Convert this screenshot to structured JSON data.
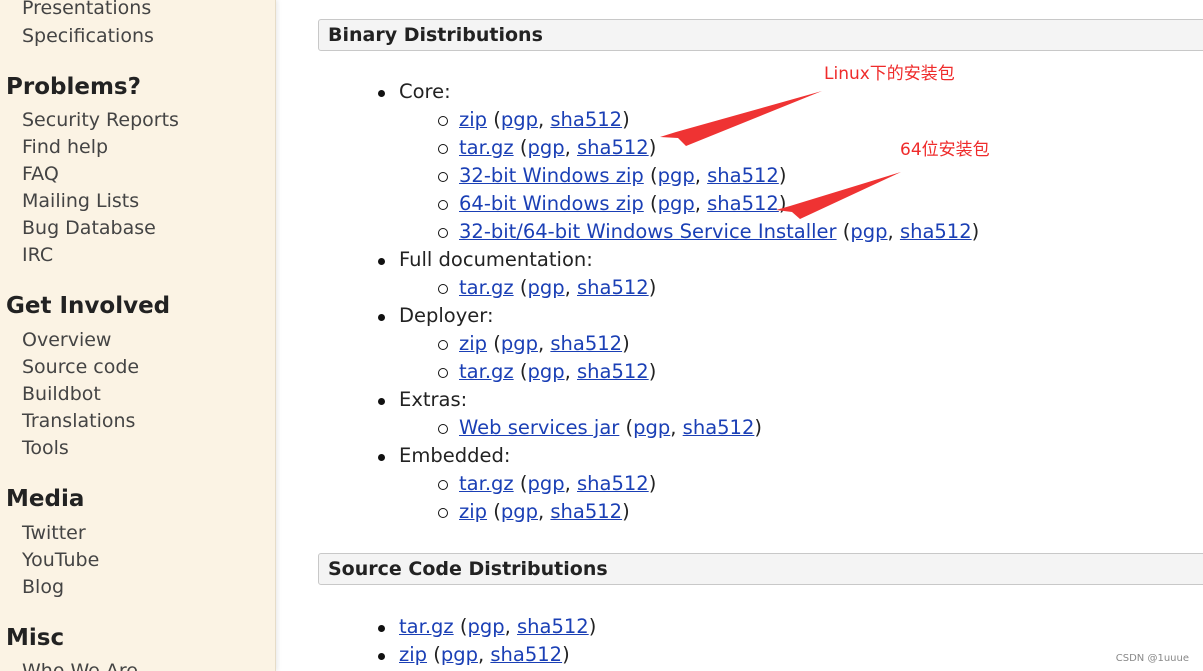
{
  "sidebar": {
    "top_items": [
      "Presentations",
      "Specifications"
    ],
    "sections": [
      {
        "heading": "Problems?",
        "items": [
          "Security Reports",
          "Find help",
          "FAQ",
          "Mailing Lists",
          "Bug Database",
          "IRC"
        ]
      },
      {
        "heading": "Get Involved",
        "items": [
          "Overview",
          "Source code",
          "Buildbot",
          "Translations",
          "Tools"
        ]
      },
      {
        "heading": "Media",
        "items": [
          "Twitter",
          "YouTube",
          "Blog"
        ]
      },
      {
        "heading": "Misc",
        "items": [
          "Who We Are"
        ]
      }
    ]
  },
  "binary": {
    "heading": "Binary Distributions",
    "core_label": "Core:",
    "core": {
      "zip": "zip",
      "zip_pgp": "pgp",
      "zip_sha": "sha512",
      "targz": "tar.gz",
      "targz_pgp": "pgp",
      "targz_sha": "sha512",
      "win32": "32-bit Windows zip",
      "win32_pgp": "pgp",
      "win32_sha": "sha512",
      "win64": "64-bit Windows zip",
      "win64_pgp": "pgp",
      "win64_sha": "sha512",
      "installer": "32-bit/64-bit Windows Service Installer",
      "installer_pgp": "pgp",
      "installer_sha": "sha512"
    },
    "fulldoc_label": "Full documentation:",
    "fulldoc": {
      "targz": "tar.gz",
      "targz_pgp": "pgp",
      "targz_sha": "sha512"
    },
    "deployer_label": "Deployer:",
    "deployer": {
      "zip": "zip",
      "zip_pgp": "pgp",
      "zip_sha": "sha512",
      "targz": "tar.gz",
      "targz_pgp": "pgp",
      "targz_sha": "sha512"
    },
    "extras_label": "Extras:",
    "extras": {
      "ws": "Web services jar",
      "ws_pgp": "pgp",
      "ws_sha": "sha512"
    },
    "embedded_label": "Embedded:",
    "embedded": {
      "targz": "tar.gz",
      "targz_pgp": "pgp",
      "targz_sha": "sha512",
      "zip": "zip",
      "zip_pgp": "pgp",
      "zip_sha": "sha512"
    }
  },
  "source": {
    "heading": "Source Code Distributions",
    "targz": "tar.gz",
    "targz_pgp": "pgp",
    "targz_sha": "sha512",
    "zip": "zip",
    "zip_pgp": "pgp",
    "zip_sha": "sha512"
  },
  "annotations": {
    "linux": "Linux下的安装包",
    "win64": "64位安装包",
    "color": "#ef2b2b"
  },
  "watermark": "CSDN @1uuue",
  "colors": {
    "link": "#1a3fb5",
    "sidebar_bg": "#fbf3e4",
    "section_head_bg": "#f4f4f4"
  }
}
